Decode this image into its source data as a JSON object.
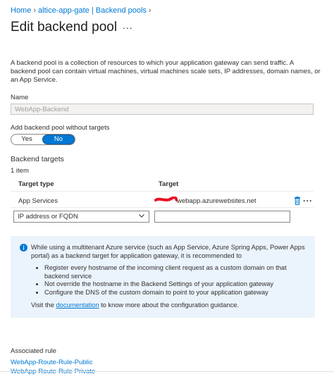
{
  "breadcrumb": [
    "Home",
    "altice-app-gate | Backend pools"
  ],
  "page_title": "Edit backend pool",
  "more_label": "...",
  "description": "A backend pool is a collection of resources to which your application gateway can send traffic. A backend pool can contain virtual machines, virtual machines scale sets, IP addresses, domain names, or an App Service.",
  "name_field": {
    "label": "Name",
    "value": "WebApp-Backend"
  },
  "no_targets": {
    "label": "Add backend pool without targets",
    "options": [
      "Yes",
      "No"
    ],
    "selected": "No"
  },
  "backend_targets": {
    "heading": "Backend targets",
    "count": "1 item",
    "columns": [
      "Target type",
      "Target"
    ],
    "rows": [
      {
        "type": "App Services",
        "target": "webapp.azurewebsites.net"
      }
    ],
    "new_row": {
      "type_placeholder": "IP address or FQDN",
      "target_value": ""
    }
  },
  "info_box": {
    "intro": "While using a multitenant Azure service (such as App Service, Azure Spring Apps, Power Apps portal) as a backend target for application gateway, it is recommended to",
    "bullets": [
      "Register every hostname of the incoming client request as a custom domain on that backend service",
      "Not override the hostname in the Backend Settings of your application gateway",
      "Configure the DNS of the custom domain to point to your application gateway"
    ],
    "visit_prefix": "Visit the",
    "visit_link": "documentation",
    "visit_suffix": "to know more about the configuration guidance."
  },
  "associated_rule": {
    "label": "Associated rule",
    "links": [
      "WebApp-Route-Rule-Public",
      "WebApp-Route-Rule-Private"
    ]
  },
  "colors": {
    "accent": "#0078d4",
    "info_bg": "#ebf3fc",
    "redaction": "#e81123"
  }
}
